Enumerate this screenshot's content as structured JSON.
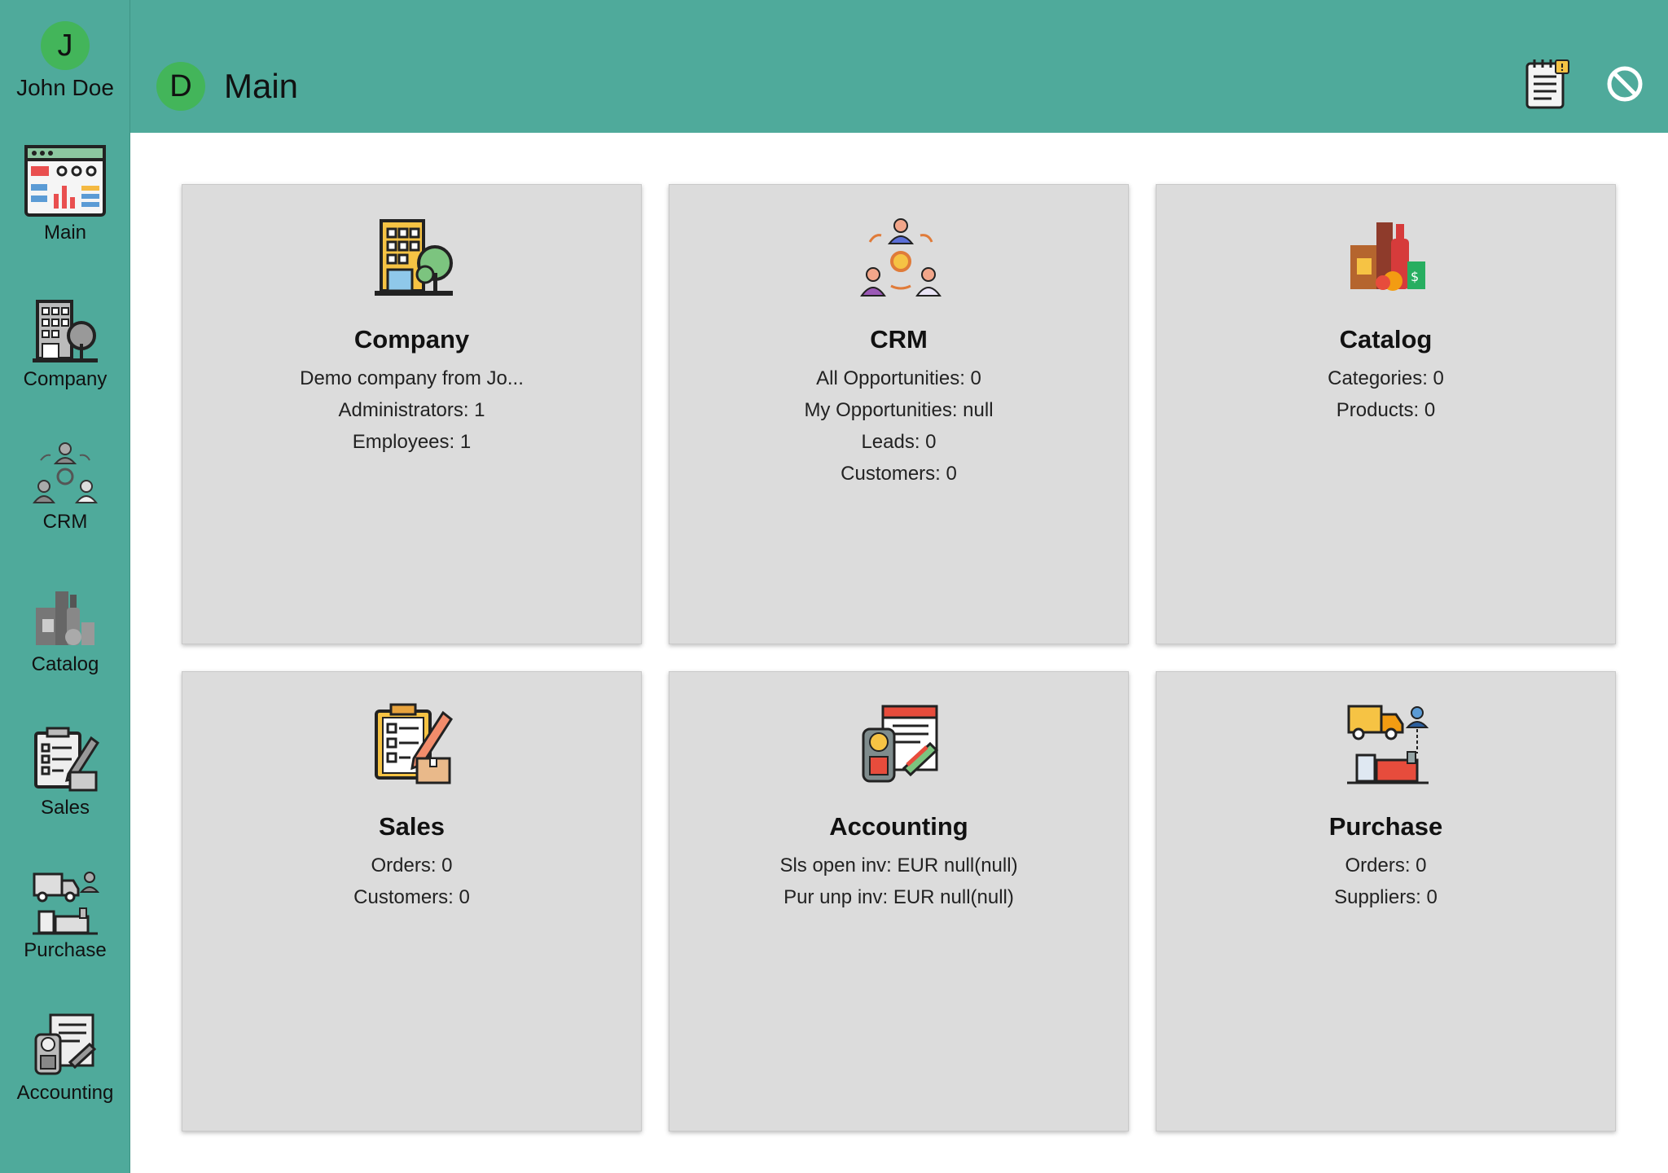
{
  "user": {
    "initial": "J",
    "name": "John Doe"
  },
  "header": {
    "initial": "D",
    "title": "Main"
  },
  "sidebar": {
    "items": [
      {
        "label": "Main",
        "icon": "dashboard-icon"
      },
      {
        "label": "Company",
        "icon": "company-building-icon"
      },
      {
        "label": "CRM",
        "icon": "crm-people-icon"
      },
      {
        "label": "Catalog",
        "icon": "catalog-products-icon"
      },
      {
        "label": "Sales",
        "icon": "sales-clipboard-icon"
      },
      {
        "label": "Purchase",
        "icon": "purchase-truck-icon"
      },
      {
        "label": "Accounting",
        "icon": "accounting-invoice-icon"
      }
    ]
  },
  "cards": [
    {
      "title": "Company",
      "icon": "company-building-icon",
      "lines": [
        "Demo company from Jo...",
        "Administrators: 1",
        "Employees: 1"
      ]
    },
    {
      "title": "CRM",
      "icon": "crm-people-icon",
      "lines": [
        "All Opportunities: 0",
        "My Opportunities: null",
        "Leads: 0",
        "Customers: 0"
      ]
    },
    {
      "title": "Catalog",
      "icon": "catalog-products-icon",
      "lines": [
        "Categories: 0",
        "Products: 0"
      ]
    },
    {
      "title": "Sales",
      "icon": "sales-clipboard-icon",
      "lines": [
        "Orders: 0",
        "Customers: 0"
      ]
    },
    {
      "title": "Accounting",
      "icon": "accounting-invoice-icon",
      "lines": [
        "Sls open inv: EUR null(null)",
        "Pur unp inv: EUR null(null)"
      ]
    },
    {
      "title": "Purchase",
      "icon": "purchase-truck-icon",
      "lines": [
        "Orders: 0",
        "Suppliers: 0"
      ]
    }
  ],
  "colors": {
    "teal": "#4faa9b",
    "avatar_green": "#43b55a",
    "card_bg": "#dcdcdc"
  }
}
